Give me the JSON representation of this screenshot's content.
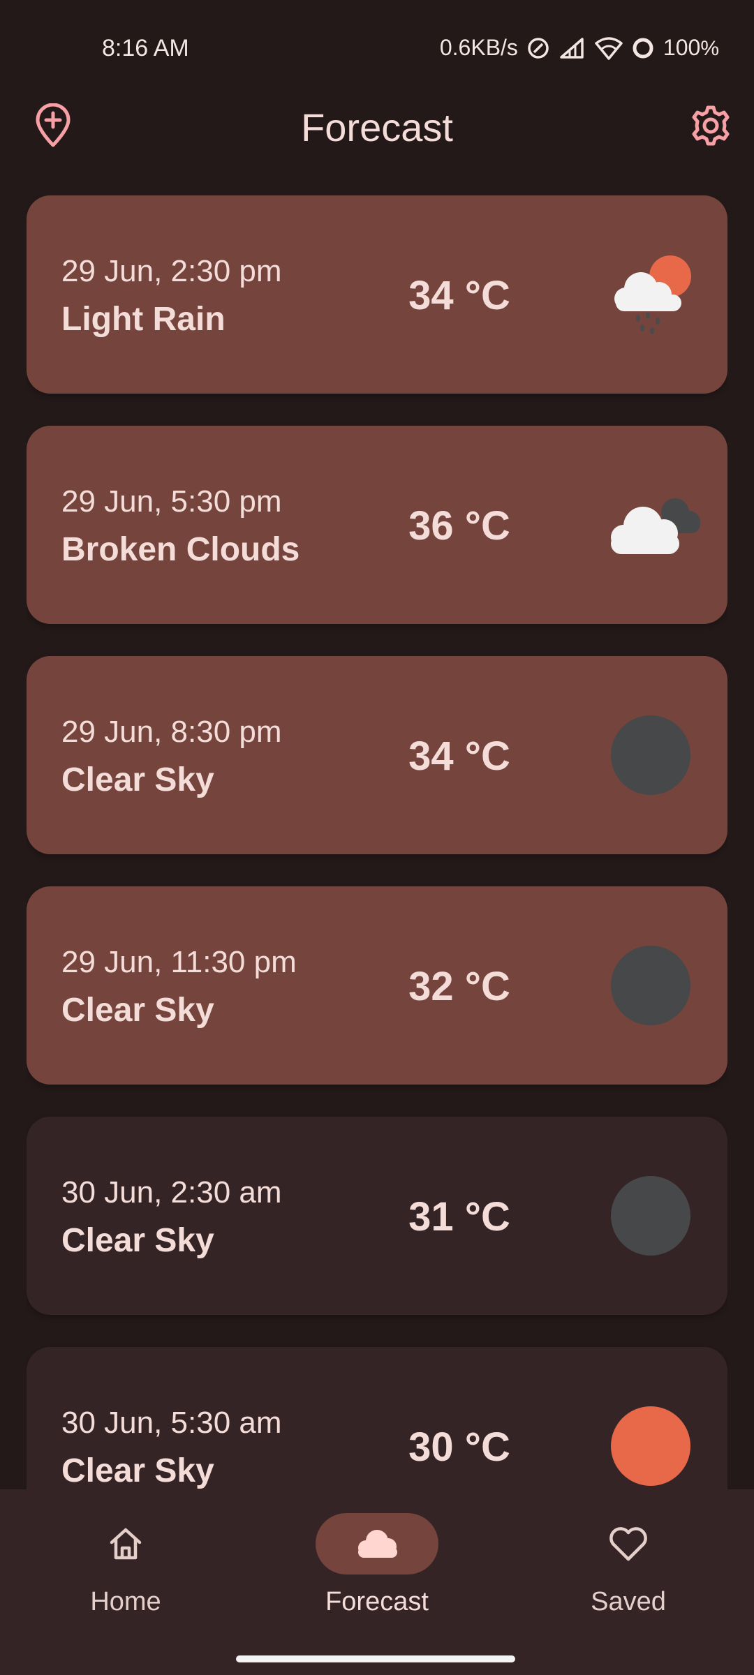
{
  "status_bar": {
    "time": "8:16 AM",
    "speed": "0.6KB/s",
    "battery": "100",
    "battery_unit": "%"
  },
  "header": {
    "title": "Forecast",
    "add_location_icon": "add-location-icon",
    "settings_icon": "gear-icon"
  },
  "colors": {
    "background": "#241919",
    "card_highlight": "#74443D",
    "card_dark": "#352425",
    "accent_sun": "#E8694A",
    "moon": "#47484A",
    "text": "#F4DCD8",
    "icon_pink": "#F7A0A6"
  },
  "forecast": [
    {
      "time": "29 Jun, 2:30 pm",
      "desc": "Light Rain",
      "temp": "34 °C",
      "icon": "rain-sun-icon"
    },
    {
      "time": "29 Jun, 5:30 pm",
      "desc": "Broken Clouds",
      "temp": "36 °C",
      "icon": "broken-clouds-icon"
    },
    {
      "time": "29 Jun, 8:30 pm",
      "desc": "Clear Sky",
      "temp": "34 °C",
      "icon": "moon-icon"
    },
    {
      "time": "29 Jun, 11:30 pm",
      "desc": "Clear Sky",
      "temp": "32 °C",
      "icon": "moon-icon"
    },
    {
      "time": "30 Jun, 2:30 am",
      "desc": "Clear Sky",
      "temp": "31 °C",
      "icon": "moon-icon"
    },
    {
      "time": "30 Jun, 5:30 am",
      "desc": "Clear Sky",
      "temp": "30 °C",
      "icon": "sun-icon"
    }
  ],
  "nav": [
    {
      "label": "Home",
      "icon": "home-icon"
    },
    {
      "label": "Forecast",
      "icon": "cloud-icon"
    },
    {
      "label": "Saved",
      "icon": "heart-icon"
    }
  ]
}
